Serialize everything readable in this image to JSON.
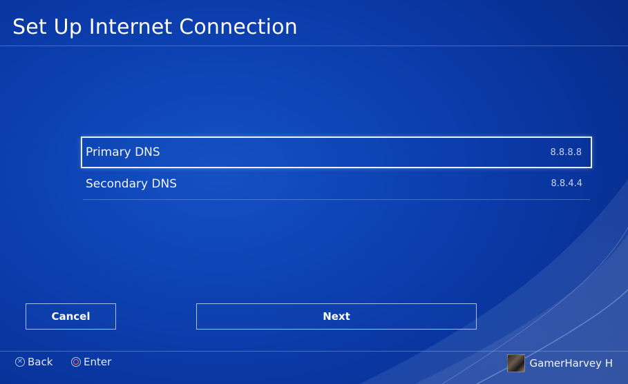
{
  "header": {
    "title": "Set Up Internet Connection"
  },
  "dns": {
    "items": [
      {
        "label": "Primary DNS",
        "value": "8.8.8.8",
        "selected": true
      },
      {
        "label": "Secondary DNS",
        "value": "8.8.4.4",
        "selected": false
      }
    ]
  },
  "buttons": {
    "cancel": "Cancel",
    "next": "Next"
  },
  "footer": {
    "back_label": "Back",
    "back_icon": "cross-button-icon",
    "enter_label": "Enter",
    "enter_icon": "circle-button-icon",
    "username": "GamerHarvey H"
  },
  "colors": {
    "background": "#0a3aa8",
    "selection_border": "#e8eefc",
    "circle_button": "#ff6b6b"
  }
}
